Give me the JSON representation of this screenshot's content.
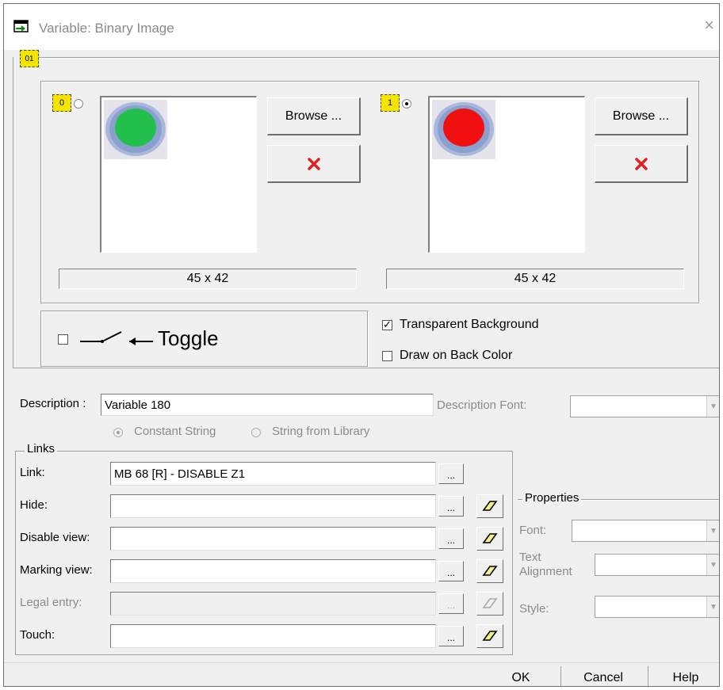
{
  "window": {
    "title": "Variable: Binary Image",
    "close_glyph": "×"
  },
  "images": {
    "state0": {
      "badge": "0",
      "browse_label": "Browse ...",
      "size": "45 x 42",
      "lamp_color": "#22c04a",
      "selected": false
    },
    "state1": {
      "badge": "1",
      "browse_label": "Browse ...",
      "size": "45 x 42",
      "lamp_color": "#f01010",
      "selected": true
    },
    "group_badge": "01"
  },
  "toggle": {
    "label": "Toggle",
    "checked": false
  },
  "options": {
    "transparent_background": {
      "label": "Transparent Background",
      "checked": true
    },
    "draw_on_back_color": {
      "label": "Draw on Back Color",
      "checked": false
    }
  },
  "description": {
    "label": "Description :",
    "value": "Variable 180",
    "font_label": "Description Font:",
    "constant_string": "Constant String",
    "string_from_library": "String from Library"
  },
  "links": {
    "legend": "Links",
    "rows": [
      {
        "label": "Link:",
        "value": "MB 68 [R] - DISABLE Z1",
        "enabled": true,
        "eraser": false
      },
      {
        "label": "Hide:",
        "value": "",
        "enabled": true,
        "eraser": true
      },
      {
        "label": "Disable view:",
        "value": "",
        "enabled": true,
        "eraser": true
      },
      {
        "label": "Marking view:",
        "value": "",
        "enabled": true,
        "eraser": true
      },
      {
        "label": "Legal entry:",
        "value": "",
        "enabled": false,
        "eraser": true
      },
      {
        "label": "Touch:",
        "value": "",
        "enabled": true,
        "eraser": true
      }
    ],
    "ellipsis": "..."
  },
  "properties": {
    "legend": "Properties",
    "font_label": "Font:",
    "text_alignment_label": "Text Alignment",
    "style_label": "Style:"
  },
  "footer": {
    "ok": "OK",
    "cancel": "Cancel",
    "help": "Help"
  },
  "colors": {
    "delete_x": "#e02020",
    "badge_yellow": "#f5e300"
  }
}
